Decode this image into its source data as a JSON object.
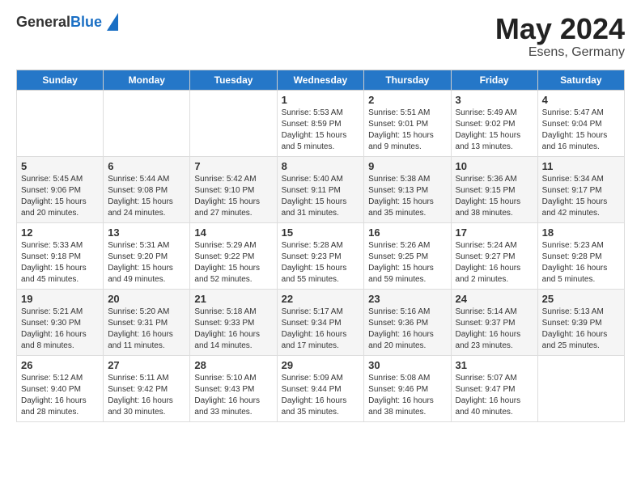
{
  "header": {
    "logo_general": "General",
    "logo_blue": "Blue",
    "title": "May 2024",
    "location": "Esens, Germany"
  },
  "days_of_week": [
    "Sunday",
    "Monday",
    "Tuesday",
    "Wednesday",
    "Thursday",
    "Friday",
    "Saturday"
  ],
  "weeks": [
    [
      {
        "day": "",
        "info": ""
      },
      {
        "day": "",
        "info": ""
      },
      {
        "day": "",
        "info": ""
      },
      {
        "day": "1",
        "info": "Sunrise: 5:53 AM\nSunset: 8:59 PM\nDaylight: 15 hours and 5 minutes."
      },
      {
        "day": "2",
        "info": "Sunrise: 5:51 AM\nSunset: 9:01 PM\nDaylight: 15 hours and 9 minutes."
      },
      {
        "day": "3",
        "info": "Sunrise: 5:49 AM\nSunset: 9:02 PM\nDaylight: 15 hours and 13 minutes."
      },
      {
        "day": "4",
        "info": "Sunrise: 5:47 AM\nSunset: 9:04 PM\nDaylight: 15 hours and 16 minutes."
      }
    ],
    [
      {
        "day": "5",
        "info": "Sunrise: 5:45 AM\nSunset: 9:06 PM\nDaylight: 15 hours and 20 minutes."
      },
      {
        "day": "6",
        "info": "Sunrise: 5:44 AM\nSunset: 9:08 PM\nDaylight: 15 hours and 24 minutes."
      },
      {
        "day": "7",
        "info": "Sunrise: 5:42 AM\nSunset: 9:10 PM\nDaylight: 15 hours and 27 minutes."
      },
      {
        "day": "8",
        "info": "Sunrise: 5:40 AM\nSunset: 9:11 PM\nDaylight: 15 hours and 31 minutes."
      },
      {
        "day": "9",
        "info": "Sunrise: 5:38 AM\nSunset: 9:13 PM\nDaylight: 15 hours and 35 minutes."
      },
      {
        "day": "10",
        "info": "Sunrise: 5:36 AM\nSunset: 9:15 PM\nDaylight: 15 hours and 38 minutes."
      },
      {
        "day": "11",
        "info": "Sunrise: 5:34 AM\nSunset: 9:17 PM\nDaylight: 15 hours and 42 minutes."
      }
    ],
    [
      {
        "day": "12",
        "info": "Sunrise: 5:33 AM\nSunset: 9:18 PM\nDaylight: 15 hours and 45 minutes."
      },
      {
        "day": "13",
        "info": "Sunrise: 5:31 AM\nSunset: 9:20 PM\nDaylight: 15 hours and 49 minutes."
      },
      {
        "day": "14",
        "info": "Sunrise: 5:29 AM\nSunset: 9:22 PM\nDaylight: 15 hours and 52 minutes."
      },
      {
        "day": "15",
        "info": "Sunrise: 5:28 AM\nSunset: 9:23 PM\nDaylight: 15 hours and 55 minutes."
      },
      {
        "day": "16",
        "info": "Sunrise: 5:26 AM\nSunset: 9:25 PM\nDaylight: 15 hours and 59 minutes."
      },
      {
        "day": "17",
        "info": "Sunrise: 5:24 AM\nSunset: 9:27 PM\nDaylight: 16 hours and 2 minutes."
      },
      {
        "day": "18",
        "info": "Sunrise: 5:23 AM\nSunset: 9:28 PM\nDaylight: 16 hours and 5 minutes."
      }
    ],
    [
      {
        "day": "19",
        "info": "Sunrise: 5:21 AM\nSunset: 9:30 PM\nDaylight: 16 hours and 8 minutes."
      },
      {
        "day": "20",
        "info": "Sunrise: 5:20 AM\nSunset: 9:31 PM\nDaylight: 16 hours and 11 minutes."
      },
      {
        "day": "21",
        "info": "Sunrise: 5:18 AM\nSunset: 9:33 PM\nDaylight: 16 hours and 14 minutes."
      },
      {
        "day": "22",
        "info": "Sunrise: 5:17 AM\nSunset: 9:34 PM\nDaylight: 16 hours and 17 minutes."
      },
      {
        "day": "23",
        "info": "Sunrise: 5:16 AM\nSunset: 9:36 PM\nDaylight: 16 hours and 20 minutes."
      },
      {
        "day": "24",
        "info": "Sunrise: 5:14 AM\nSunset: 9:37 PM\nDaylight: 16 hours and 23 minutes."
      },
      {
        "day": "25",
        "info": "Sunrise: 5:13 AM\nSunset: 9:39 PM\nDaylight: 16 hours and 25 minutes."
      }
    ],
    [
      {
        "day": "26",
        "info": "Sunrise: 5:12 AM\nSunset: 9:40 PM\nDaylight: 16 hours and 28 minutes."
      },
      {
        "day": "27",
        "info": "Sunrise: 5:11 AM\nSunset: 9:42 PM\nDaylight: 16 hours and 30 minutes."
      },
      {
        "day": "28",
        "info": "Sunrise: 5:10 AM\nSunset: 9:43 PM\nDaylight: 16 hours and 33 minutes."
      },
      {
        "day": "29",
        "info": "Sunrise: 5:09 AM\nSunset: 9:44 PM\nDaylight: 16 hours and 35 minutes."
      },
      {
        "day": "30",
        "info": "Sunrise: 5:08 AM\nSunset: 9:46 PM\nDaylight: 16 hours and 38 minutes."
      },
      {
        "day": "31",
        "info": "Sunrise: 5:07 AM\nSunset: 9:47 PM\nDaylight: 16 hours and 40 minutes."
      },
      {
        "day": "",
        "info": ""
      }
    ]
  ]
}
